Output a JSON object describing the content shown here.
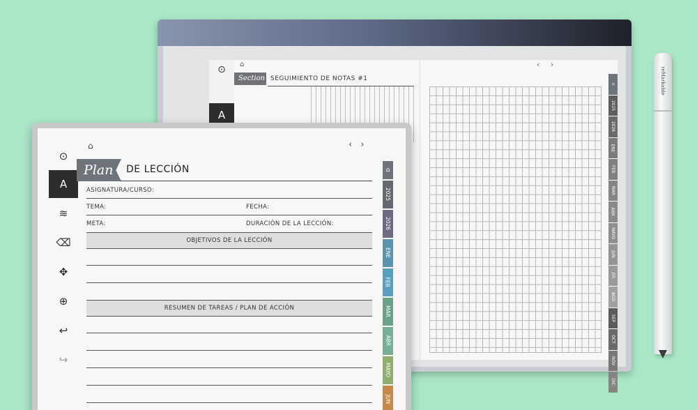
{
  "back_device": {
    "section_label": "Section",
    "title": "SEGUIMIENTO DE NOTAS #1",
    "nav": "‹ ›",
    "home_glyph": "⌂",
    "tool_first_glyph": "⊙",
    "tool_selected_glyph": "A",
    "tabs": [
      {
        "label": "⌂",
        "color": "#6f747a"
      },
      {
        "label": "2025",
        "color": "#5e5e5e"
      },
      {
        "label": "2026",
        "color": "#6a6a6a"
      },
      {
        "label": "ENE",
        "color": "#7a7a7a"
      },
      {
        "label": "FEB",
        "color": "#808080"
      },
      {
        "label": "MAR",
        "color": "#858585"
      },
      {
        "label": "ABR",
        "color": "#8a8a8a"
      },
      {
        "label": "MAYO",
        "color": "#8f8f8f"
      },
      {
        "label": "JUN",
        "color": "#949494"
      },
      {
        "label": "JUL",
        "color": "#9a9a9a"
      },
      {
        "label": "AGO",
        "color": "#a0a0a0"
      },
      {
        "label": "SEP",
        "color": "#5c5c5c"
      },
      {
        "label": "OCT",
        "color": "#6a6a6a"
      },
      {
        "label": "NOV",
        "color": "#787878"
      },
      {
        "label": "DIC",
        "color": "#858585"
      }
    ]
  },
  "pen": {
    "brand": "reMarkable"
  },
  "front_device": {
    "home_glyph": "⌂",
    "nav_prev": "‹",
    "nav_next": "›",
    "banner": "Plan",
    "title": "DE LECCIÓN",
    "fields": {
      "subject": "ASIGNATURA/CURSO:",
      "topic": "TEMA:",
      "date": "FECHA:",
      "goal": "META:",
      "duration": "DURACIÓN DE LA LECCIÓN:"
    },
    "sections": {
      "objectives": "OBJETIVOS DE LA LECCIÓN",
      "summary": "RESUMEN DE TAREAS / PLAN DE ACCIÓN"
    },
    "tools": {
      "first": "⊙",
      "pen": "A",
      "lines": "≋",
      "eraser": "⌫",
      "move": "✥",
      "zoom": "⊕",
      "undo": "↩",
      "redo": "↪"
    },
    "tabs": [
      {
        "label": "⌂",
        "color": "#6f747a"
      },
      {
        "label": "2025",
        "color": "#666a70"
      },
      {
        "label": "2026",
        "color": "#6d6a82"
      },
      {
        "label": "ENE",
        "color": "#5b93ae"
      },
      {
        "label": "FEB",
        "color": "#5a9ec0"
      },
      {
        "label": "MAR",
        "color": "#6aa28a"
      },
      {
        "label": "ABR",
        "color": "#77ae96"
      },
      {
        "label": "MAYO",
        "color": "#8fae6e"
      },
      {
        "label": "JUN",
        "color": "#c58a4a"
      }
    ]
  }
}
